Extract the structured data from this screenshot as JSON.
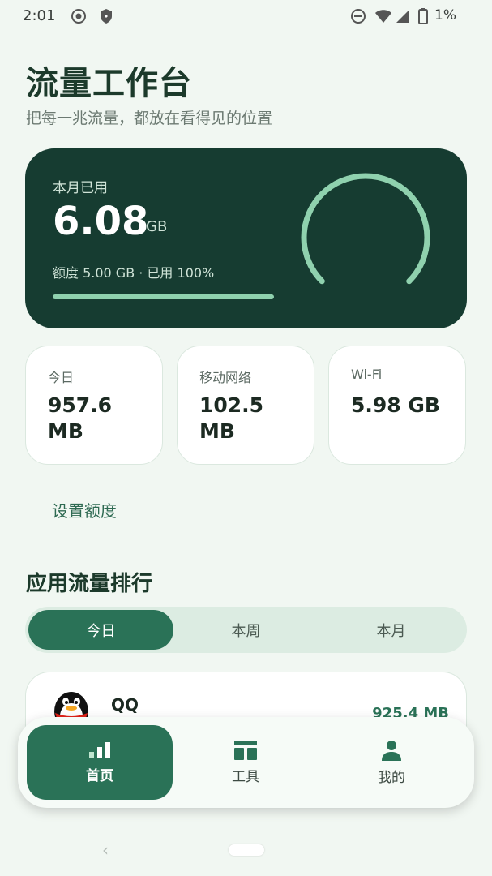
{
  "status": {
    "time": "2:01",
    "battery": "1%",
    "icons": [
      "record-icon",
      "shield-icon",
      "dnd-icon",
      "wifi-icon",
      "signal-icon",
      "battery-icon"
    ]
  },
  "header": {
    "title": "流量工作台",
    "subtitle": "把每一兆流量，都放在看得见的位置"
  },
  "usage": {
    "label": "本月已用",
    "value": "6.08",
    "unit": "GB",
    "quota_text": "额度 5.00 GB · 已用 100%",
    "progress_fraction": 1.0
  },
  "stats": [
    {
      "label": "今日",
      "value": "957.6 MB"
    },
    {
      "label": "移动网络",
      "value": "102.5 MB"
    },
    {
      "label": "Wi-Fi",
      "value": "5.98 GB"
    }
  ],
  "set_quota_label": "设置额度",
  "ranking": {
    "title": "应用流量排行",
    "tabs": [
      "今日",
      "本周",
      "本月"
    ],
    "active_tab": 0,
    "apps": [
      {
        "name": "QQ",
        "usage": "925.4 MB",
        "icon": "qq-penguin-icon"
      }
    ]
  },
  "nav": {
    "items": [
      {
        "label": "首页",
        "icon": "bar-chart-icon"
      },
      {
        "label": "工具",
        "icon": "tools-icon"
      },
      {
        "label": "我的",
        "icon": "person-icon"
      }
    ],
    "active": 0
  },
  "colors": {
    "accent": "#2a7257",
    "card_dark": "#163c31",
    "gauge": "#8fd1ae",
    "background": "#f1f7f2"
  }
}
